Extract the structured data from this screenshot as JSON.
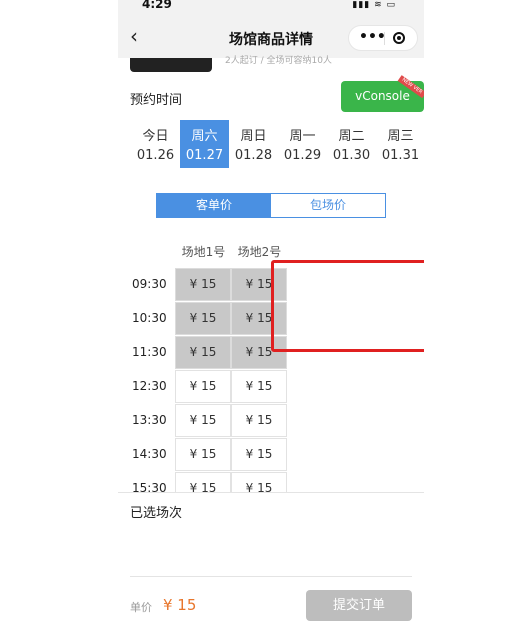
{
  "status_bar": {
    "time": "4:29",
    "indicators": "▮▮▮ ≋ ▭"
  },
  "nav": {
    "title": "场馆商品详情",
    "back_icon": "chevron-left-icon",
    "more_label": "•••"
  },
  "header_partial": {
    "text": "2人起订 / 全场可容纳10人"
  },
  "booking": {
    "section_title": "预约时间",
    "days": [
      {
        "weekday": "今日",
        "date": "01.26",
        "active": false
      },
      {
        "weekday": "周六",
        "date": "01.27",
        "active": true
      },
      {
        "weekday": "周日",
        "date": "01.28",
        "active": false
      },
      {
        "weekday": "周一",
        "date": "01.29",
        "active": false
      },
      {
        "weekday": "周二",
        "date": "01.30",
        "active": false
      },
      {
        "weekday": "周三",
        "date": "01.31",
        "active": false
      }
    ],
    "price_tabs": [
      {
        "label": "客单价",
        "selected": true
      },
      {
        "label": "包场价",
        "selected": false
      }
    ],
    "venues": [
      "场地1号",
      "场地2号"
    ],
    "slots": [
      {
        "time": "09:30",
        "prices": [
          "¥ 15",
          "¥ 15"
        ],
        "booked": true
      },
      {
        "time": "10:30",
        "prices": [
          "¥ 15",
          "¥ 15"
        ],
        "booked": true
      },
      {
        "time": "11:30",
        "prices": [
          "¥ 15",
          "¥ 15"
        ],
        "booked": true
      },
      {
        "time": "12:30",
        "prices": [
          "¥ 15",
          "¥ 15"
        ],
        "booked": false
      },
      {
        "time": "13:30",
        "prices": [
          "¥ 15",
          "¥ 15"
        ],
        "booked": false
      },
      {
        "time": "14:30",
        "prices": [
          "¥ 15",
          "¥ 15"
        ],
        "booked": false
      },
      {
        "time": "15:30",
        "prices": [
          "¥ 15",
          "¥ 15"
        ],
        "booked": false
      }
    ]
  },
  "vconsole": {
    "label": "vConsole",
    "ribbon": "NEW VER"
  },
  "selected": {
    "label": "已选场次"
  },
  "footer": {
    "unit_label": "单价",
    "unit_price": "¥ 15",
    "submit_label": "提交订单"
  },
  "colors": {
    "accent": "#4a90e2",
    "price": "#e8762c",
    "booked": "#c8c8c8",
    "annotation": "#e02020",
    "vconsole": "#3ab54a"
  }
}
